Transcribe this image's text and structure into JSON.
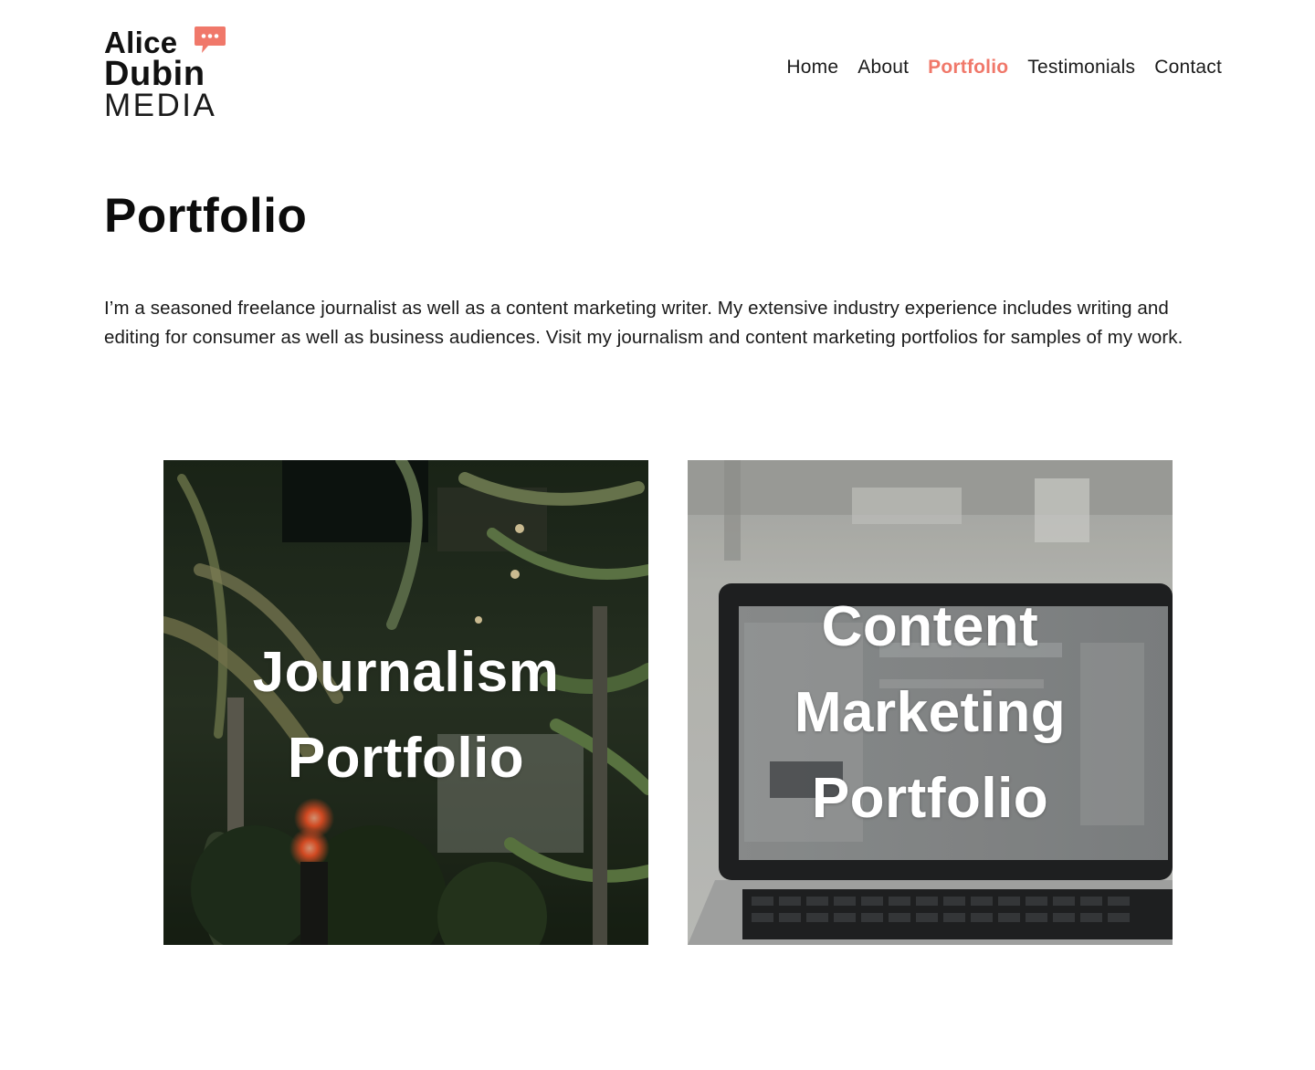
{
  "brand": {
    "line1": "Alice",
    "line2": "Dubin",
    "line3": "MEDIA",
    "bubble_icon": "speech-bubble-icon",
    "accent_color": "#f0786a"
  },
  "nav": {
    "items": [
      {
        "label": "Home",
        "active": false
      },
      {
        "label": "About",
        "active": false
      },
      {
        "label": "Portfolio",
        "active": true
      },
      {
        "label": "Testimonials",
        "active": false
      },
      {
        "label": "Contact",
        "active": false
      }
    ]
  },
  "page": {
    "title": "Portfolio",
    "intro": "I’m a seasoned freelance journalist as well as a content marketing writer. My extensive industry experience includes writing and editing for consumer as well as business audiences. Visit my journalism and content marketing portfolios for samples of my work."
  },
  "cards": [
    {
      "line1": "Journalism",
      "line2": "Portfolio"
    },
    {
      "line1": "Content",
      "line2": "Marketing",
      "line3": "Portfolio"
    }
  ]
}
